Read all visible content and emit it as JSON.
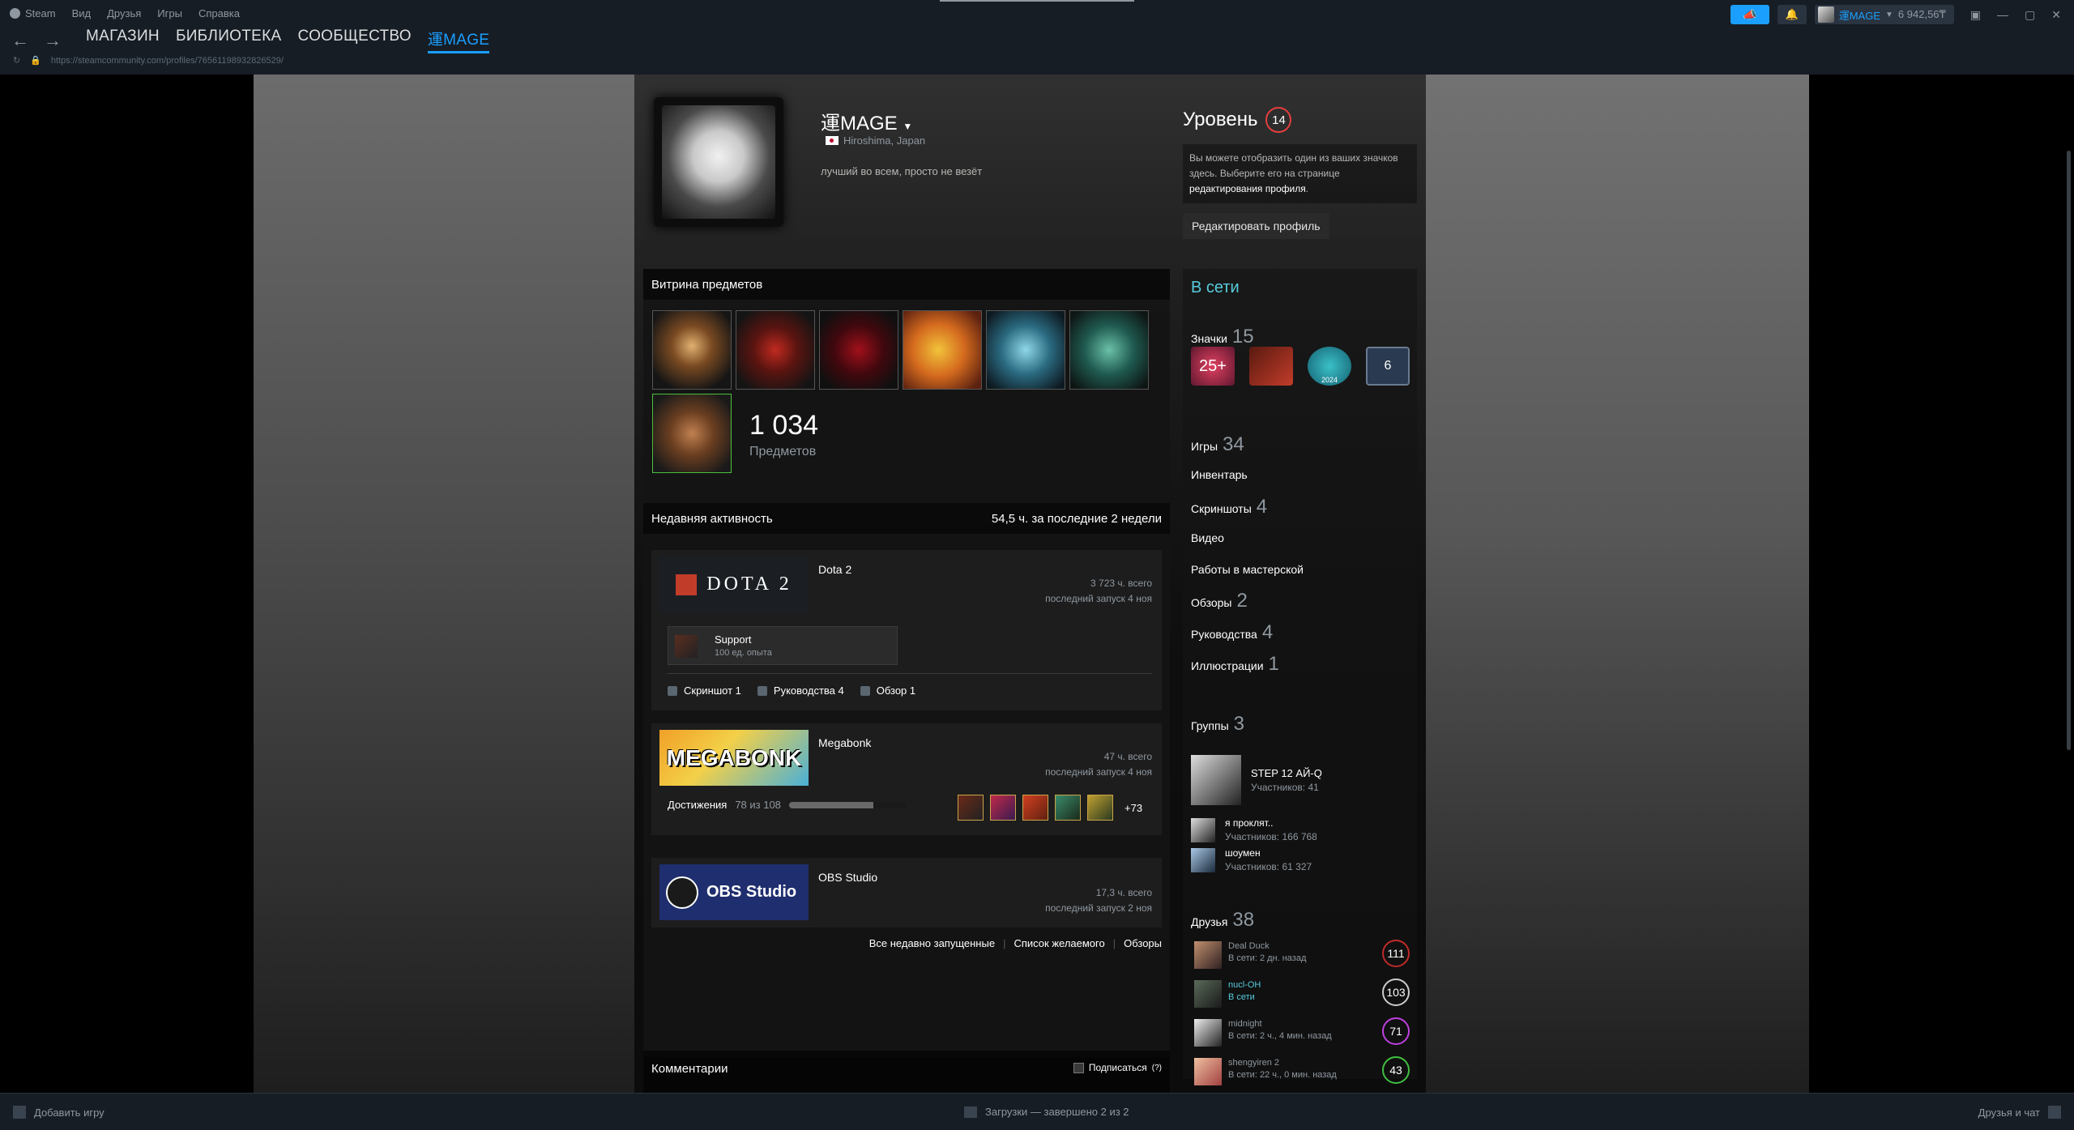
{
  "menu": {
    "steam": "Steam",
    "view": "Вид",
    "friends": "Друзья",
    "games": "Игры",
    "help": "Справка"
  },
  "nav": {
    "store": "МАГАЗИН",
    "library": "БИБЛИОТЕКА",
    "community": "СООБЩЕСТВО",
    "profile": "運MAGE"
  },
  "url": "https://steamcommunity.com/profiles/76561198932826529/",
  "account": {
    "name": "運MAGE",
    "balance": "6 942,56₸"
  },
  "profile": {
    "name": "運MAGE",
    "location": "Hiroshima, Japan",
    "summary": "лучший во всем, просто не везёт"
  },
  "level": {
    "title": "Уровень",
    "value": "14",
    "hint_text": "Вы можете отобразить один из ваших значков здесь. Выберите его на странице",
    "hint_link": "редактирования профиля",
    "edit_button": "Редактировать профиль"
  },
  "showcase": {
    "title": "Витрина предметов",
    "count": "1 034",
    "count_label": "Предметов"
  },
  "activity": {
    "title": "Недавняя активность",
    "summary": "54,5 ч. за последние 2 недели",
    "games": [
      {
        "name": "Dota 2",
        "logo": "DOTA 2",
        "total": "3 723 ч. всего",
        "last": "последний запуск 4 ноя",
        "support_title": "Support",
        "support_sub": "100 ед. опыта",
        "links": [
          "Скриншот 1",
          "Руководства 4",
          "Обзор 1"
        ]
      },
      {
        "name": "Megabonk",
        "logo": "MEGABONK",
        "total": "47 ч. всего",
        "last": "последний запуск 4 ноя",
        "ach_label": "Достижения",
        "ach_count": "78 из 108",
        "ach_progress": 0.72,
        "ach_more": "+73"
      },
      {
        "name": "OBS Studio",
        "logo": "OBS Studio",
        "total": "17,3 ч. всего",
        "last": "последний запуск 2 ноя"
      }
    ],
    "footer": {
      "recent": "Все недавно запущенные",
      "wishlist": "Список желаемого",
      "reviews": "Обзоры"
    }
  },
  "comments": {
    "title": "Комментарии",
    "subscribe": "Подписаться",
    "help": "(?)"
  },
  "sidebar": {
    "status": "В сети",
    "badges_label": "Значки",
    "badges_count": "15",
    "badge_items": [
      "25+",
      "",
      "2024",
      "6"
    ],
    "games_label": "Игры",
    "games_count": "34",
    "inventory": "Инвентарь",
    "screenshots_label": "Скриншоты",
    "screenshots_count": "4",
    "videos": "Видео",
    "workshop": "Работы в мастерской",
    "reviews_label": "Обзоры",
    "reviews_count": "2",
    "guides_label": "Руководства",
    "guides_count": "4",
    "art_label": "Иллюстрации",
    "art_count": "1",
    "groups_label": "Группы",
    "groups_count": "3",
    "groups": [
      {
        "name": "STEP 12 АЙ-Q",
        "members": "Участников: 41"
      },
      {
        "name": "я проклят..",
        "members": "Участников: 166 768"
      },
      {
        "name": "шоумен",
        "members": "Участников: 61 327"
      }
    ],
    "friends_label": "Друзья",
    "friends_count": "38",
    "friends": [
      {
        "name": "Deal Duck",
        "status": "В сети: 2 дн. назад",
        "level": "111"
      },
      {
        "name": "nucl-OH",
        "status": "В сети",
        "level": "103"
      },
      {
        "name": "midnight",
        "status": "В сети: 2 ч., 4 мин. назад",
        "level": "71"
      },
      {
        "name": "shengyiren 2",
        "status": "В сети: 22 ч., 0 мин. назад",
        "level": "43"
      }
    ]
  },
  "bottom": {
    "add_game": "Добавить игру",
    "downloads": "Загрузки — завершено 2 из 2",
    "friends_chat": "Друзья и чат"
  }
}
